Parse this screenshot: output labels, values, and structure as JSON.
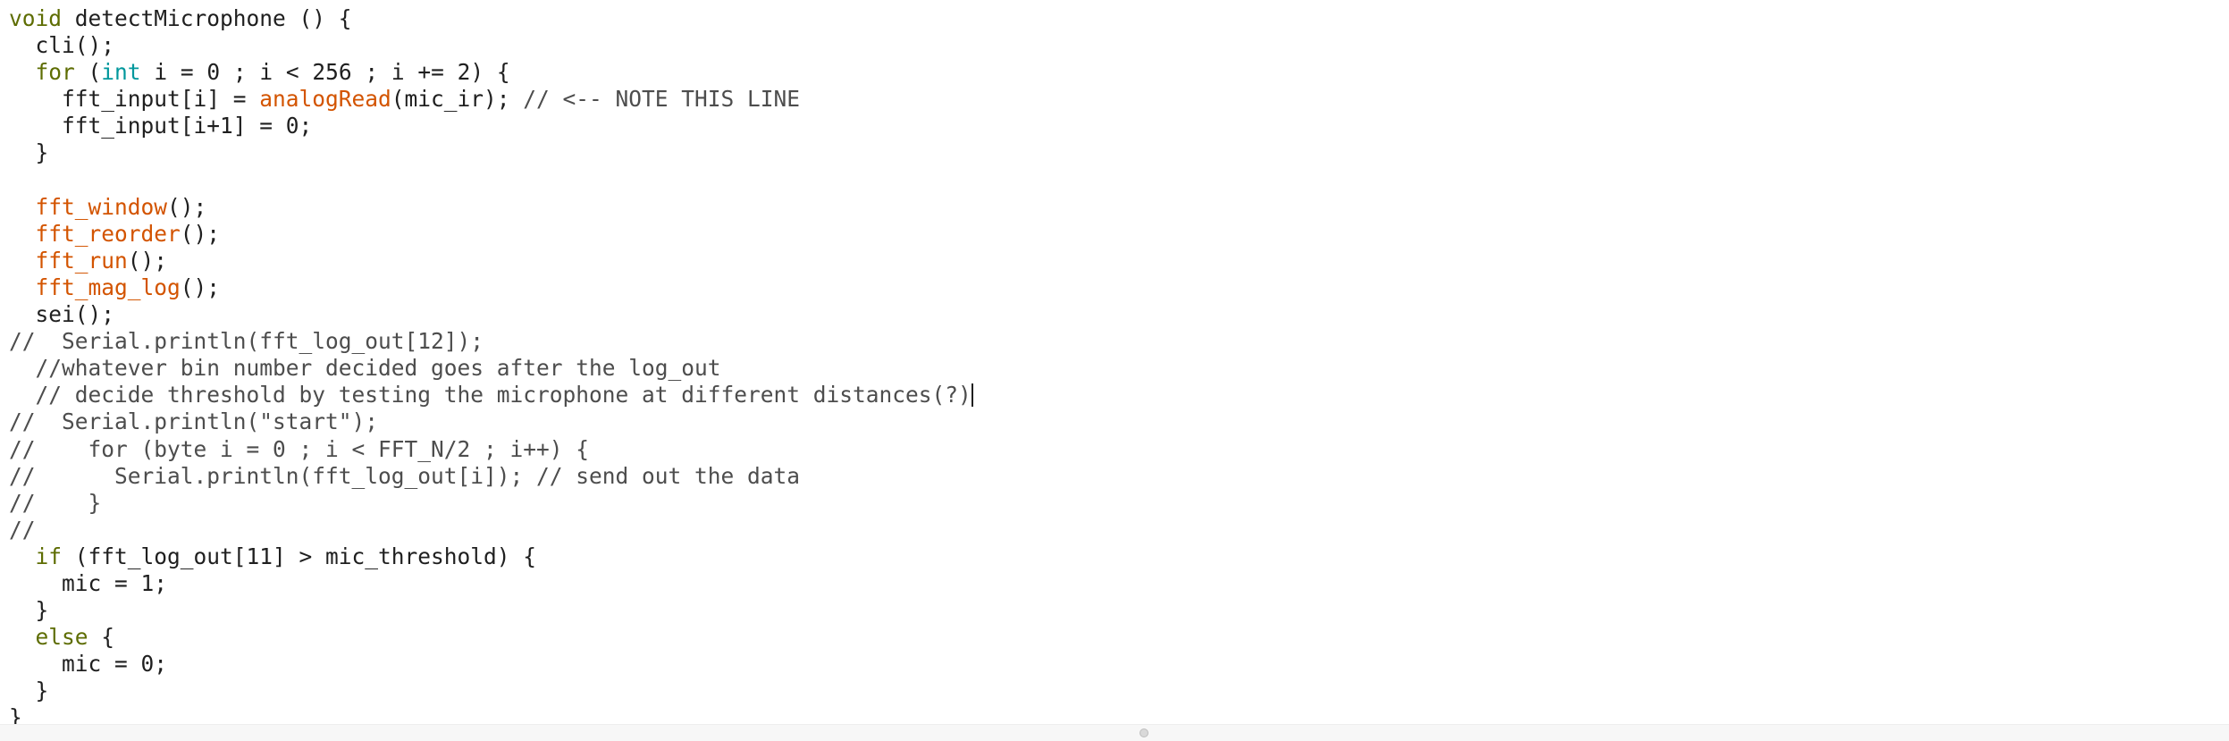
{
  "editor": {
    "lines": [
      [
        {
          "t": "void",
          "k": "kw"
        },
        {
          "t": " detectMicrophone () {",
          "k": "plain"
        }
      ],
      [
        {
          "t": "  cli();",
          "k": "plain"
        }
      ],
      [
        {
          "t": "  ",
          "k": "plain"
        },
        {
          "t": "for",
          "k": "kw"
        },
        {
          "t": " (",
          "k": "plain"
        },
        {
          "t": "int",
          "k": "type"
        },
        {
          "t": " i = 0 ; i < 256 ; i += 2) {",
          "k": "plain"
        }
      ],
      [
        {
          "t": "    fft_input[i] = ",
          "k": "plain"
        },
        {
          "t": "analogRead",
          "k": "fn"
        },
        {
          "t": "(mic_ir); ",
          "k": "plain"
        },
        {
          "t": "// <-- NOTE THIS LINE",
          "k": "comment"
        }
      ],
      [
        {
          "t": "    fft_input[i+1] = 0;",
          "k": "plain"
        }
      ],
      [
        {
          "t": "  }",
          "k": "plain"
        }
      ],
      [
        {
          "t": "",
          "k": "plain"
        }
      ],
      [
        {
          "t": "  ",
          "k": "plain"
        },
        {
          "t": "fft_window",
          "k": "fn"
        },
        {
          "t": "();",
          "k": "plain"
        }
      ],
      [
        {
          "t": "  ",
          "k": "plain"
        },
        {
          "t": "fft_reorder",
          "k": "fn"
        },
        {
          "t": "();",
          "k": "plain"
        }
      ],
      [
        {
          "t": "  ",
          "k": "plain"
        },
        {
          "t": "fft_run",
          "k": "fn"
        },
        {
          "t": "();",
          "k": "plain"
        }
      ],
      [
        {
          "t": "  ",
          "k": "plain"
        },
        {
          "t": "fft_mag_log",
          "k": "fn"
        },
        {
          "t": "();",
          "k": "plain"
        }
      ],
      [
        {
          "t": "  sei();",
          "k": "plain"
        }
      ],
      [
        {
          "t": "//  Serial.println(fft_log_out[12]);",
          "k": "comment"
        }
      ],
      [
        {
          "t": "  ",
          "k": "plain"
        },
        {
          "t": "//whatever bin number decided goes after the log_out",
          "k": "comment"
        }
      ],
      [
        {
          "t": "  ",
          "k": "plain"
        },
        {
          "t": "// decide threshold by testing the microphone at different distances(?)",
          "k": "comment"
        },
        {
          "t": "",
          "k": "caret"
        }
      ],
      [
        {
          "t": "//  Serial.println(\"start\");",
          "k": "comment"
        }
      ],
      [
        {
          "t": "//    for (byte i = 0 ; i < FFT_N/2 ; i++) {",
          "k": "comment"
        }
      ],
      [
        {
          "t": "//      Serial.println(fft_log_out[i]); // send out the data",
          "k": "comment"
        }
      ],
      [
        {
          "t": "//    }",
          "k": "comment"
        }
      ],
      [
        {
          "t": "//",
          "k": "comment"
        }
      ],
      [
        {
          "t": "  ",
          "k": "plain"
        },
        {
          "t": "if",
          "k": "kw"
        },
        {
          "t": " (fft_log_out[11] > mic_threshold) {",
          "k": "plain"
        }
      ],
      [
        {
          "t": "    mic = 1;",
          "k": "plain"
        }
      ],
      [
        {
          "t": "  }",
          "k": "plain"
        }
      ],
      [
        {
          "t": "  ",
          "k": "plain"
        },
        {
          "t": "else",
          "k": "kw"
        },
        {
          "t": " {",
          "k": "plain"
        }
      ],
      [
        {
          "t": "    mic = 0;",
          "k": "plain"
        }
      ],
      [
        {
          "t": "  }",
          "k": "plain"
        }
      ],
      [
        {
          "t": "}",
          "k": "plain"
        }
      ]
    ]
  },
  "colors": {
    "keyword": "#5e6d03",
    "type": "#00979c",
    "function": "#d35400",
    "comment": "#4d4d4d",
    "text": "#1f1f1f",
    "background": "#ffffff"
  }
}
